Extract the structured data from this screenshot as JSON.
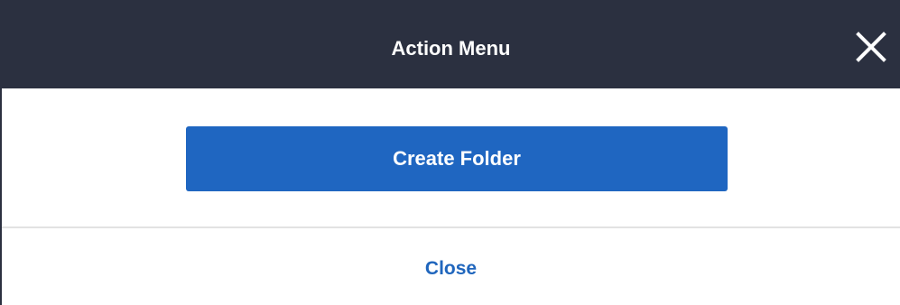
{
  "header": {
    "title": "Action Menu",
    "close_icon": "close-icon",
    "background_color": "#2b3040"
  },
  "actions": {
    "create_folder_label": "Create Folder",
    "button_color": "#1f66c1"
  },
  "footer": {
    "close_label": "Close",
    "link_color": "#2066bd"
  }
}
